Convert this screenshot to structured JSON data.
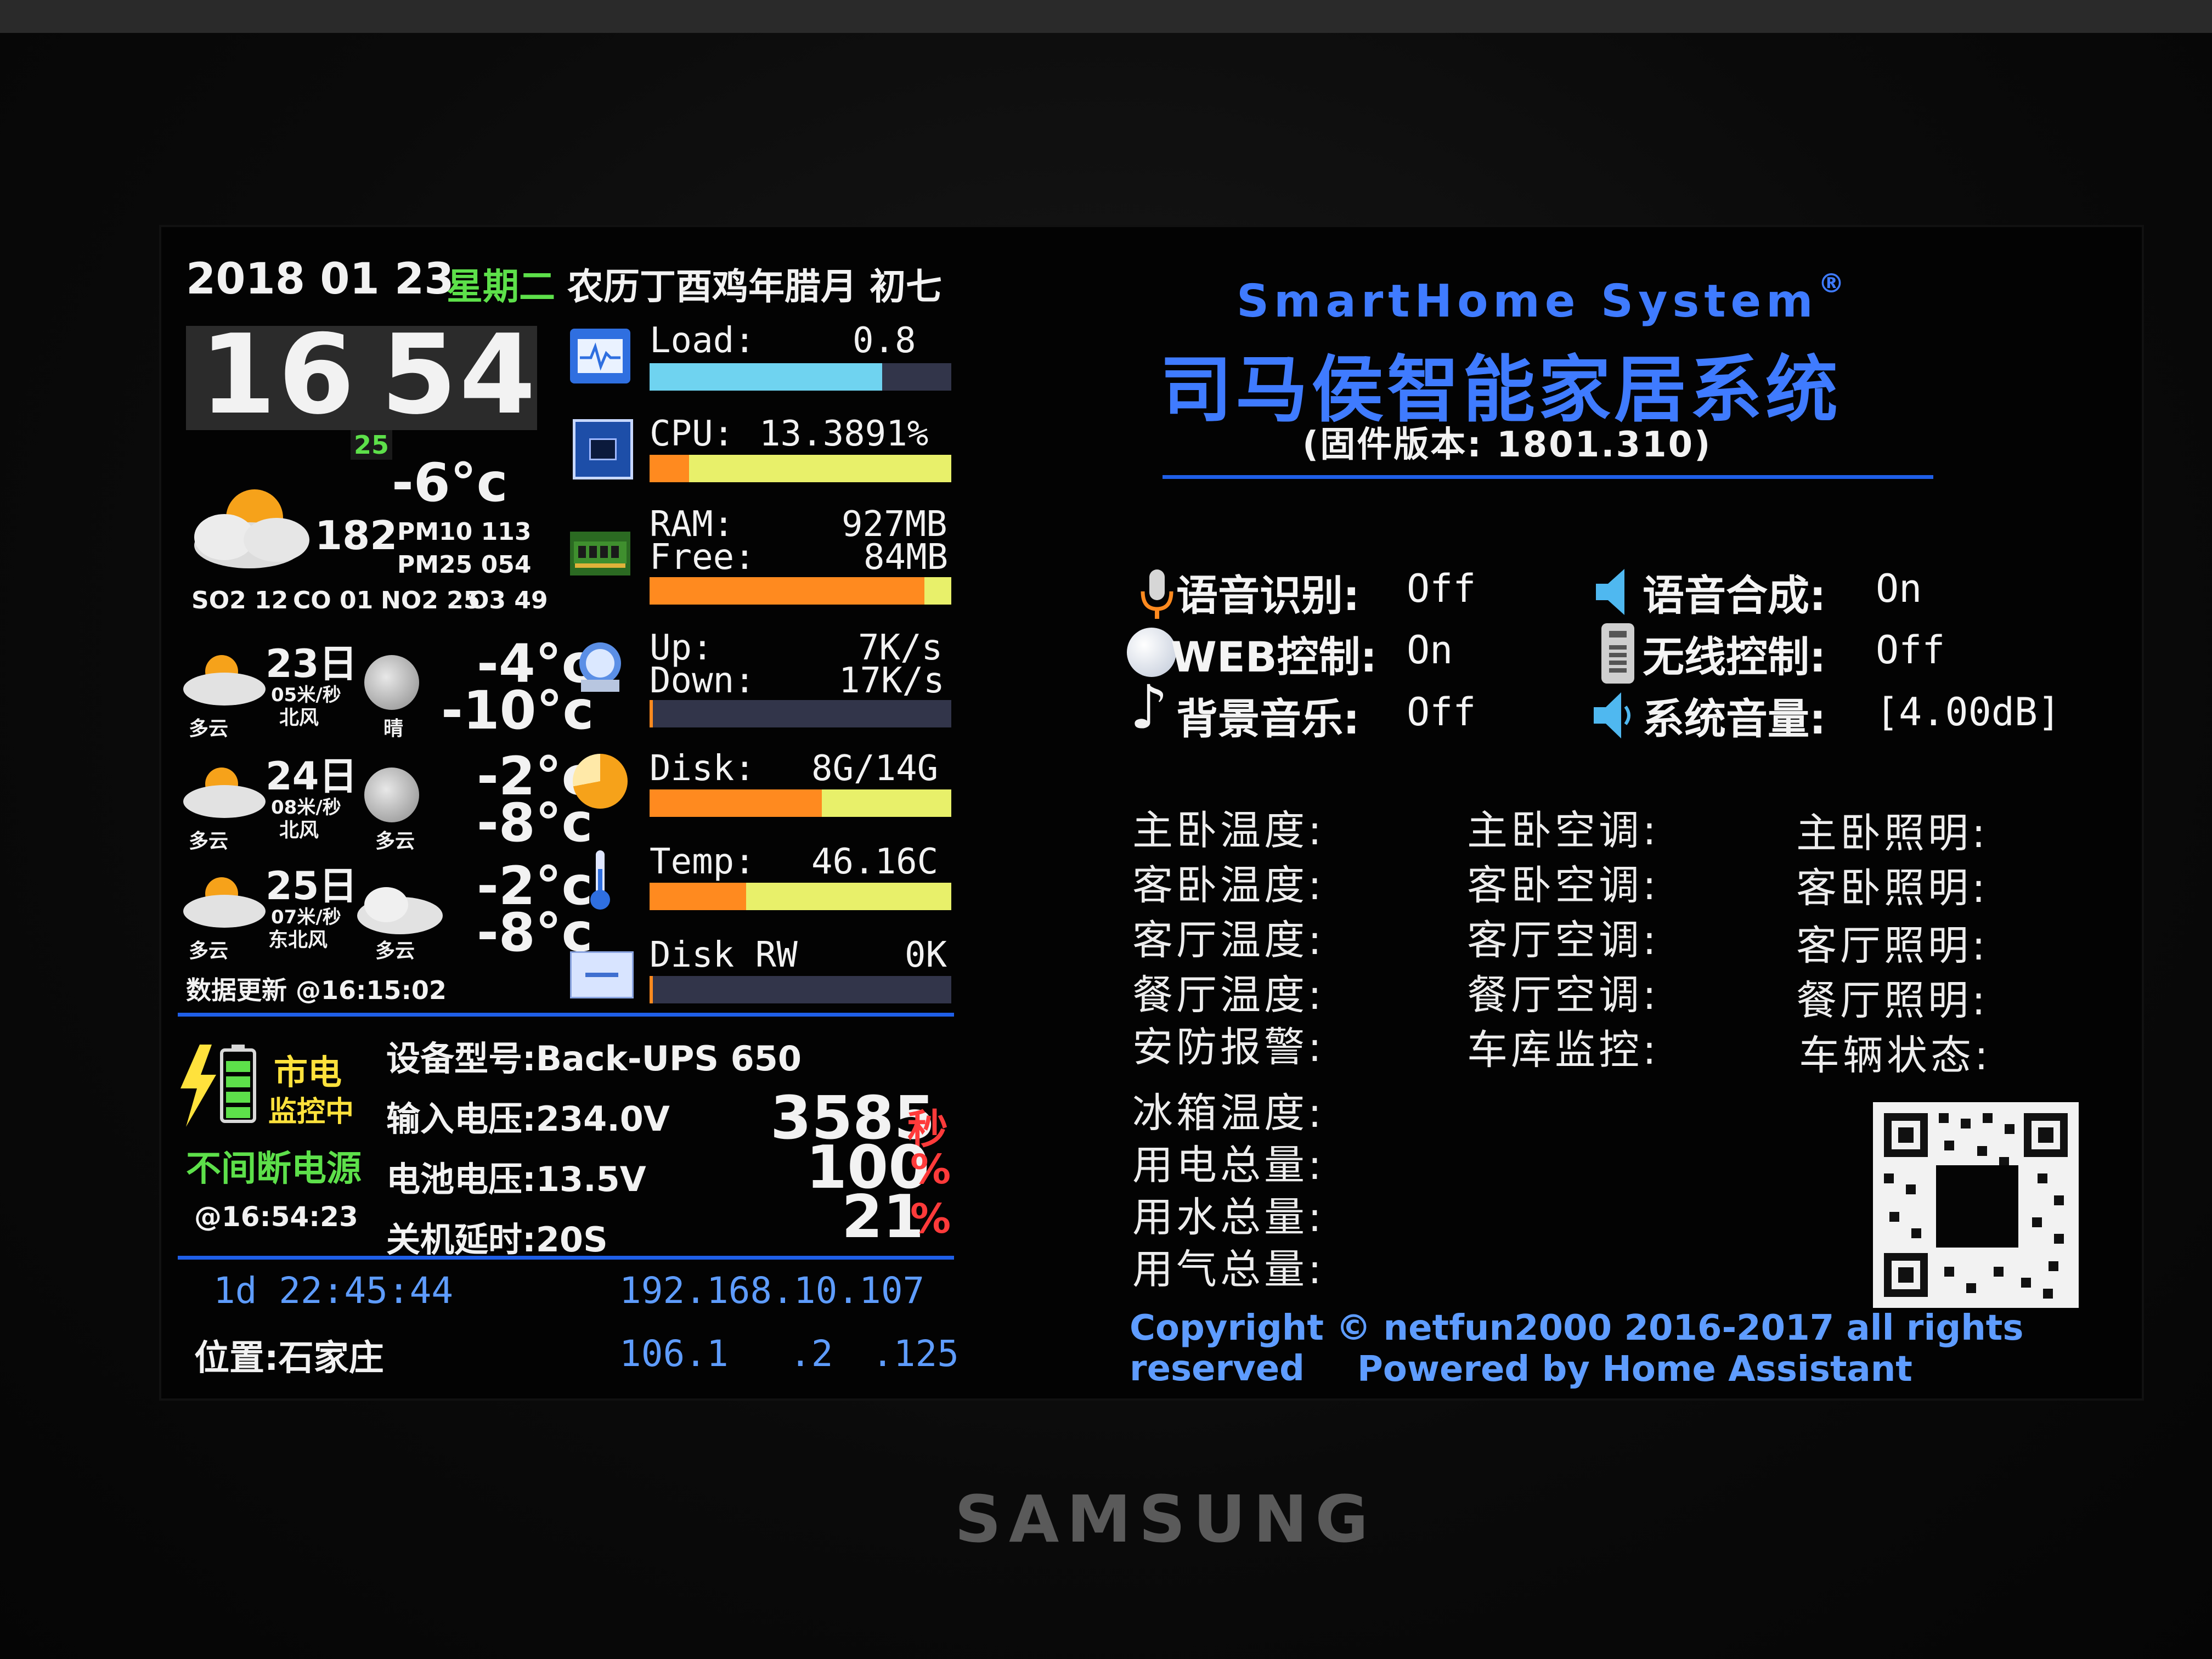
{
  "header": {
    "date": "2018 01 23",
    "weekday": "星期二",
    "lunar": "农历丁酉鸡年腊月 初七"
  },
  "clock": {
    "hour": "16",
    "minute": "54",
    "second": "25"
  },
  "weather_now": {
    "temp": "-6°c",
    "aqi": "182",
    "pm10": "PM10 113",
    "pm25": "PM25 054",
    "so2": "SO2 12",
    "co": "CO 01",
    "no2": "NO2 25",
    "o3": "O3 49"
  },
  "forecast": [
    {
      "day": "23日",
      "wind_speed": "05米/秒",
      "wind_dir": "北风",
      "cond_day": "多云",
      "cond_night": "晴",
      "high": "-4°c",
      "low": "-10°c"
    },
    {
      "day": "24日",
      "wind_speed": "08米/秒",
      "wind_dir": "北风",
      "cond_day": "多云",
      "cond_night": "多云",
      "high": "-2°c",
      "low": "-8°c"
    },
    {
      "day": "25日",
      "wind_speed": "07米/秒",
      "wind_dir": "东北风",
      "cond_day": "多云",
      "cond_night": "多云",
      "high": "-2°c",
      "low": "-8°c"
    }
  ],
  "data_update": "数据更新 @16:15:02",
  "system": {
    "load_label": "Load:",
    "load_value": "0.8",
    "load_fraction": 0.77,
    "cpu_label": "CPU:",
    "cpu_value": "13.3891%",
    "cpu_fraction": 0.13,
    "ram_label": "RAM:",
    "ram_value": "927MB",
    "free_label": "Free:",
    "free_value": "84MB",
    "ram_fraction": 0.91,
    "up_label": "Up:",
    "up_value": "7K/s",
    "down_label": "Down:",
    "down_value": "17K/s",
    "net_fraction": 0.01,
    "disk_label": "Disk:",
    "disk_value": "8G/14G",
    "disk_fraction": 0.57,
    "temp_label": "Temp:",
    "temp_value": "46.16C",
    "temp_fraction": 0.32,
    "diskrw_label": "Disk RW",
    "diskrw_value": "0K",
    "diskrw_fraction": 0.01
  },
  "ups": {
    "mains": "市电",
    "monitoring": "监控中",
    "title": "不间断电源",
    "time": "@16:54:23",
    "model": "设备型号:Back-UPS 650",
    "input_voltage": "输入电压:234.0V",
    "battery_voltage": "电池电压:13.5V",
    "shutdown_delay": "关机延时:20S",
    "runtime": "3585",
    "runtime_unit": "秒",
    "charge": "100",
    "charge_unit": "%",
    "load": "21",
    "load_unit": "%"
  },
  "footer_left": {
    "uptime": "1d 22:45:44",
    "location": "位置:石家庄",
    "ip": "192.168.10.107",
    "ip2a": "106.1",
    "ip2b": ".2",
    "ip2c": ".125"
  },
  "brand": {
    "title_en": "SmartHome System",
    "reg": "®",
    "title_cn": "司马侯智能家居系统",
    "firmware": "(固件版本: 1801.310)"
  },
  "controls": [
    {
      "label": "语音识别:",
      "value": "Off",
      "icon": "microphone-icon"
    },
    {
      "label": "语音合成:",
      "value": "On",
      "icon": "speaker-icon"
    },
    {
      "label": "WEB控制:",
      "value": "On",
      "icon": "globe-icon"
    },
    {
      "label": "无线控制:",
      "value": "Off",
      "icon": "remote-icon"
    },
    {
      "label": "背景音乐:",
      "value": "Off",
      "icon": "music-note-icon"
    },
    {
      "label": "系统音量:",
      "value": "[4.00dB]",
      "icon": "volume-icon"
    }
  ],
  "rooms": {
    "col1": [
      "主卧温度:",
      "客卧温度:",
      "客厅温度:",
      "餐厅温度:",
      "安防报警:"
    ],
    "col2": [
      "主卧空调:",
      "客卧空调:",
      "客厅空调:",
      "餐厅空调:",
      "车库监控:"
    ],
    "col3": [
      "主卧照明:",
      "客卧照明:",
      "客厅照明:",
      "餐厅照明:",
      "车辆状态:"
    ],
    "extra": [
      "冰箱温度:",
      "用电总量:",
      "用水总量:",
      "用气总量:"
    ]
  },
  "copyright": "Copyright © netfun2000 2016-2017 all rights reserved",
  "powered": "Powered by Home Assistant",
  "device_brand": "SAMSUNG",
  "colors": {
    "accent_blue": "#1f5fe8",
    "bar_cyan": "#6fd3f0",
    "bar_orange": "#ff8a1f",
    "bar_yellow": "#e8f06a",
    "green": "#5de04a",
    "red": "#ff3a3a"
  }
}
